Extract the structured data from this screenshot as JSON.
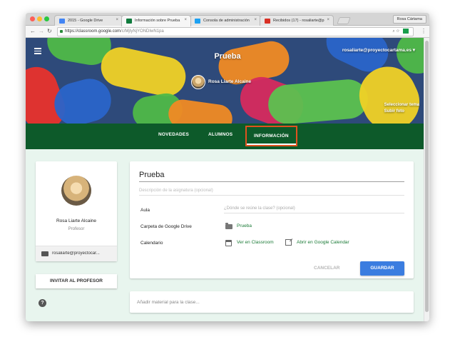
{
  "browser": {
    "tabs": [
      {
        "label": "2015 - Google Drive",
        "fav_color": "#4285f4"
      },
      {
        "label": "Información sobre Prueba",
        "fav_color": "#0f7b3d"
      },
      {
        "label": "Consola de administración",
        "fav_color": "#1da1f2"
      },
      {
        "label": "Recibidos (17) - rosaliarte@p",
        "fav_color": "#d93025"
      }
    ],
    "close_glyph": "×",
    "profile": "Rosa Cártama",
    "url_host": "https://classroom.google.com",
    "url_path": "/c/MjIyNjYONDIwN1pa",
    "icons": {
      "back": "back-arrow-icon",
      "forward": "forward-arrow-icon",
      "reload": "reload-icon"
    }
  },
  "banner": {
    "class_name": "Prueba",
    "account": "rosaliarte@proyectocartama.es ▾",
    "teacher": "Rosa Liarte Alcaine",
    "select_theme": "Seleccionar tema",
    "upload_photo": "Subir foto"
  },
  "nav": {
    "tabs": [
      "NOVEDADES",
      "ALUMNOS",
      "INFORMACIÓN"
    ],
    "active": "INFORMACIÓN"
  },
  "teacher_card": {
    "name": "Rosa Liarte Alcaine",
    "role": "Profesor",
    "email": "rosaliarte@proyectocar..."
  },
  "invite_button": "INVITAR AL PROFESOR",
  "help": "?",
  "about": {
    "title": "Prueba",
    "description_placeholder": "Descripción de la asignatura (opcional)",
    "room_label": "Aula",
    "room_placeholder": "¿Dónde se reúne la clase? (opcional)",
    "drive_label": "Carpeta de Google Drive",
    "drive_folder": "Prueba",
    "calendar_label": "Calendario",
    "view_classroom": "Ver en Classroom",
    "open_calendar": "Abrir en Google Calendar",
    "cancel": "CANCELAR",
    "save": "GUARDAR"
  },
  "material_placeholder": "Añadir material para la clase..."
}
